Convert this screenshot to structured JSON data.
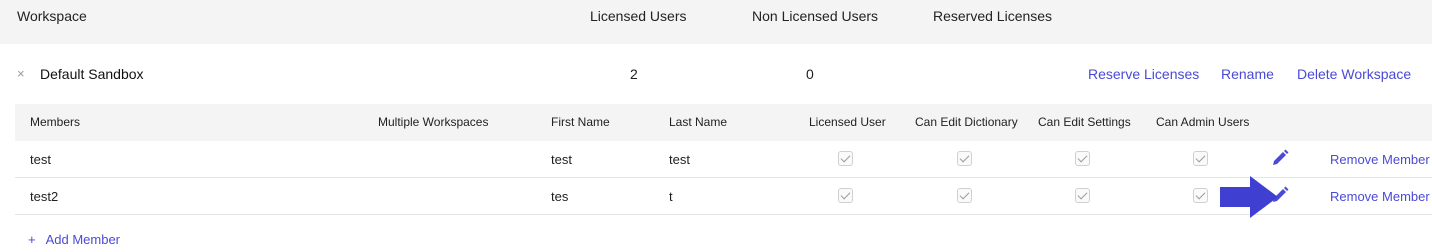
{
  "header": {
    "workspace": "Workspace",
    "licensed_users": "Licensed Users",
    "non_licensed_users": "Non Licensed Users",
    "reserved_licenses": "Reserved Licenses"
  },
  "workspace_row": {
    "close": "×",
    "name": "Default Sandbox",
    "licensed_count": "2",
    "non_licensed_count": "0",
    "reserve_link": "Reserve Licenses",
    "rename_link": "Rename",
    "delete_link": "Delete Workspace"
  },
  "members_table": {
    "columns": [
      "Members",
      "Multiple Workspaces",
      "First Name",
      "Last Name",
      "Licensed User",
      "Can Edit Dictionary",
      "Can Edit Settings",
      "Can Admin Users"
    ],
    "rows": [
      {
        "member": "test",
        "first_name": "test",
        "last_name": "test",
        "licensed": true,
        "edit_dictionary": true,
        "edit_settings": true,
        "admin_users": true,
        "remove_label": "Remove Member"
      },
      {
        "member": "test2",
        "first_name": "tes",
        "last_name": "t",
        "licensed": true,
        "edit_dictionary": true,
        "edit_settings": true,
        "admin_users": true,
        "remove_label": "Remove Member"
      }
    ]
  },
  "add_member": {
    "plus": "+",
    "label": "Add Member"
  },
  "colors": {
    "accent": "#4a4ad6",
    "arrow": "#3f3fd2",
    "header_bg": "#f4f4f5"
  },
  "icons": {
    "edit": "pencil-icon",
    "close": "close-icon",
    "pointer": "arrow-annotation"
  }
}
